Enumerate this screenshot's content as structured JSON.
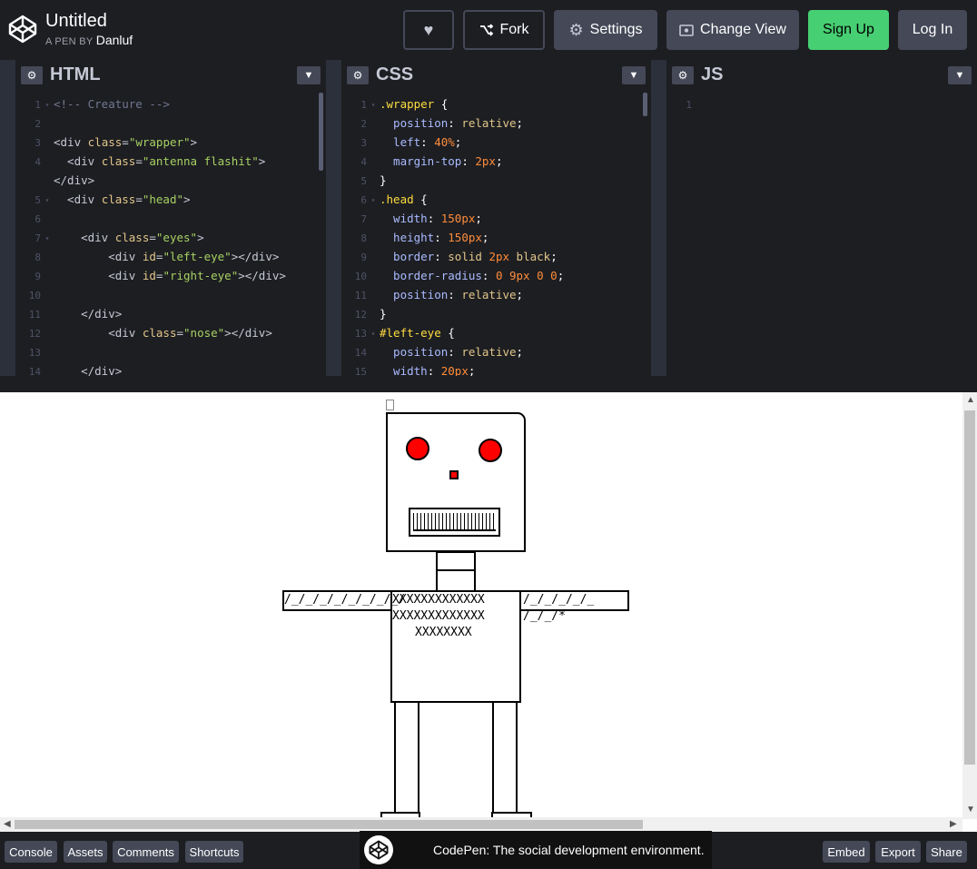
{
  "header": {
    "title": "Untitled",
    "byline_prefix": "A PEN BY",
    "author": "Danluf",
    "buttons": {
      "heart": "♥",
      "fork": "Fork",
      "settings": "Settings",
      "change_view": "Change View",
      "sign_up": "Sign Up",
      "log_in": "Log In"
    }
  },
  "panels": [
    {
      "title": "HTML",
      "lines": [
        {
          "n": "1",
          "fold": "▾",
          "parts": [
            [
              "t-com",
              "<!-- Creature -->"
            ]
          ]
        },
        {
          "n": "2",
          "fold": "",
          "parts": []
        },
        {
          "n": "3",
          "fold": "",
          "parts": [
            [
              "t-tag",
              "<div "
            ],
            [
              "t-attr",
              "class"
            ],
            [
              "t-tag",
              "="
            ],
            [
              "t-str",
              "\"wrapper\""
            ],
            [
              "t-tag",
              ">"
            ]
          ]
        },
        {
          "n": "4",
          "fold": "",
          "parts": [
            [
              "t-tag",
              "  <div "
            ],
            [
              "t-attr",
              "class"
            ],
            [
              "t-tag",
              "="
            ],
            [
              "t-str",
              "\"antenna flashit\""
            ],
            [
              "t-tag",
              ">"
            ]
          ]
        },
        {
          "n": "",
          "fold": "",
          "parts": [
            [
              "t-tag",
              "</div>"
            ]
          ]
        },
        {
          "n": "5",
          "fold": "▾",
          "parts": [
            [
              "t-tag",
              "  <div "
            ],
            [
              "t-attr",
              "class"
            ],
            [
              "t-tag",
              "="
            ],
            [
              "t-str",
              "\"head\""
            ],
            [
              "t-tag",
              ">"
            ]
          ]
        },
        {
          "n": "6",
          "fold": "",
          "parts": []
        },
        {
          "n": "7",
          "fold": "▾",
          "parts": [
            [
              "t-tag",
              "    <div "
            ],
            [
              "t-attr",
              "class"
            ],
            [
              "t-tag",
              "="
            ],
            [
              "t-str",
              "\"eyes\""
            ],
            [
              "t-tag",
              ">"
            ]
          ]
        },
        {
          "n": "8",
          "fold": "",
          "parts": [
            [
              "t-tag",
              "        <div "
            ],
            [
              "t-attr",
              "id"
            ],
            [
              "t-tag",
              "="
            ],
            [
              "t-str",
              "\"left-eye\""
            ],
            [
              "t-tag",
              "></div>"
            ]
          ]
        },
        {
          "n": "9",
          "fold": "",
          "parts": [
            [
              "t-tag",
              "        <div "
            ],
            [
              "t-attr",
              "id"
            ],
            [
              "t-tag",
              "="
            ],
            [
              "t-str",
              "\"right-eye\""
            ],
            [
              "t-tag",
              "></div>"
            ]
          ]
        },
        {
          "n": "10",
          "fold": "",
          "parts": []
        },
        {
          "n": "11",
          "fold": "",
          "parts": [
            [
              "t-tag",
              "    </div>"
            ]
          ]
        },
        {
          "n": "12",
          "fold": "",
          "parts": [
            [
              "t-tag",
              "        <div "
            ],
            [
              "t-attr",
              "class"
            ],
            [
              "t-tag",
              "="
            ],
            [
              "t-str",
              "\"nose\""
            ],
            [
              "t-tag",
              "></div>"
            ]
          ]
        },
        {
          "n": "13",
          "fold": "",
          "parts": []
        },
        {
          "n": "14",
          "fold": "",
          "parts": [
            [
              "t-tag",
              "    </div>"
            ]
          ]
        }
      ]
    },
    {
      "title": "CSS",
      "lines": [
        {
          "n": "1",
          "fold": "▾",
          "parts": [
            [
              "t-sel",
              ".wrapper"
            ],
            [
              "t-val",
              " {"
            ]
          ]
        },
        {
          "n": "2",
          "fold": "",
          "parts": [
            [
              "t-prop",
              "  position"
            ],
            [
              "t-val",
              ": "
            ],
            [
              "t-attr",
              "relative"
            ],
            [
              "t-val",
              ";"
            ]
          ]
        },
        {
          "n": "3",
          "fold": "",
          "parts": [
            [
              "t-prop",
              "  left"
            ],
            [
              "t-val",
              ": "
            ],
            [
              "t-num",
              "40%"
            ],
            [
              "t-val",
              ";"
            ]
          ]
        },
        {
          "n": "4",
          "fold": "",
          "parts": [
            [
              "t-prop",
              "  margin-top"
            ],
            [
              "t-val",
              ": "
            ],
            [
              "t-num",
              "2px"
            ],
            [
              "t-val",
              ";"
            ]
          ]
        },
        {
          "n": "5",
          "fold": "",
          "parts": [
            [
              "t-val",
              "}"
            ]
          ]
        },
        {
          "n": "6",
          "fold": "▾",
          "parts": [
            [
              "t-sel",
              ".head"
            ],
            [
              "t-val",
              " {"
            ]
          ]
        },
        {
          "n": "7",
          "fold": "",
          "parts": [
            [
              "t-prop",
              "  width"
            ],
            [
              "t-val",
              ": "
            ],
            [
              "t-num",
              "150px"
            ],
            [
              "t-val",
              ";"
            ]
          ]
        },
        {
          "n": "8",
          "fold": "",
          "parts": [
            [
              "t-prop",
              "  height"
            ],
            [
              "t-val",
              ": "
            ],
            [
              "t-num",
              "150px"
            ],
            [
              "t-val",
              ";"
            ]
          ]
        },
        {
          "n": "9",
          "fold": "",
          "parts": [
            [
              "t-prop",
              "  border"
            ],
            [
              "t-val",
              ": "
            ],
            [
              "t-attr",
              "solid "
            ],
            [
              "t-num",
              "2px "
            ],
            [
              "t-attr",
              "black"
            ],
            [
              "t-val",
              ";"
            ]
          ]
        },
        {
          "n": "10",
          "fold": "",
          "parts": [
            [
              "t-prop",
              "  border-radius"
            ],
            [
              "t-val",
              ": "
            ],
            [
              "t-num",
              "0 9px 0 0"
            ],
            [
              "t-val",
              ";"
            ]
          ]
        },
        {
          "n": "11",
          "fold": "",
          "parts": [
            [
              "t-prop",
              "  position"
            ],
            [
              "t-val",
              ": "
            ],
            [
              "t-attr",
              "relative"
            ],
            [
              "t-val",
              ";"
            ]
          ]
        },
        {
          "n": "12",
          "fold": "",
          "parts": [
            [
              "t-val",
              "}"
            ]
          ]
        },
        {
          "n": "13",
          "fold": "▾",
          "parts": [
            [
              "t-sel",
              "#left-eye"
            ],
            [
              "t-val",
              " {"
            ]
          ]
        },
        {
          "n": "14",
          "fold": "",
          "parts": [
            [
              "t-prop",
              "  position"
            ],
            [
              "t-val",
              ": "
            ],
            [
              "t-attr",
              "relative"
            ],
            [
              "t-val",
              ";"
            ]
          ]
        },
        {
          "n": "15",
          "fold": "",
          "parts": [
            [
              "t-prop",
              "  width"
            ],
            [
              "t-val",
              ": "
            ],
            [
              "t-num",
              "20px"
            ],
            [
              "t-val",
              ";"
            ]
          ]
        }
      ]
    },
    {
      "title": "JS",
      "lines": [
        {
          "n": "1",
          "fold": "",
          "parts": []
        }
      ]
    }
  ],
  "preview": {
    "arms_left": "/_/_/_/_/_/_/_/_/",
    "body_row1": "XXXXXXXXXXXXX",
    "arms_right": "/_/_/_/_/_",
    "body_row2": "XXXXXXXXXXXXX",
    "arms_right2": "/_/_/*",
    "body_row3": "XXXXXXXX"
  },
  "footer": {
    "console": "Console",
    "assets": "Assets",
    "comments": "Comments",
    "shortcuts": "Shortcuts",
    "toast": "CodePen: The social development environment.",
    "embed": "Embed",
    "export": "Export",
    "share": "Share"
  }
}
